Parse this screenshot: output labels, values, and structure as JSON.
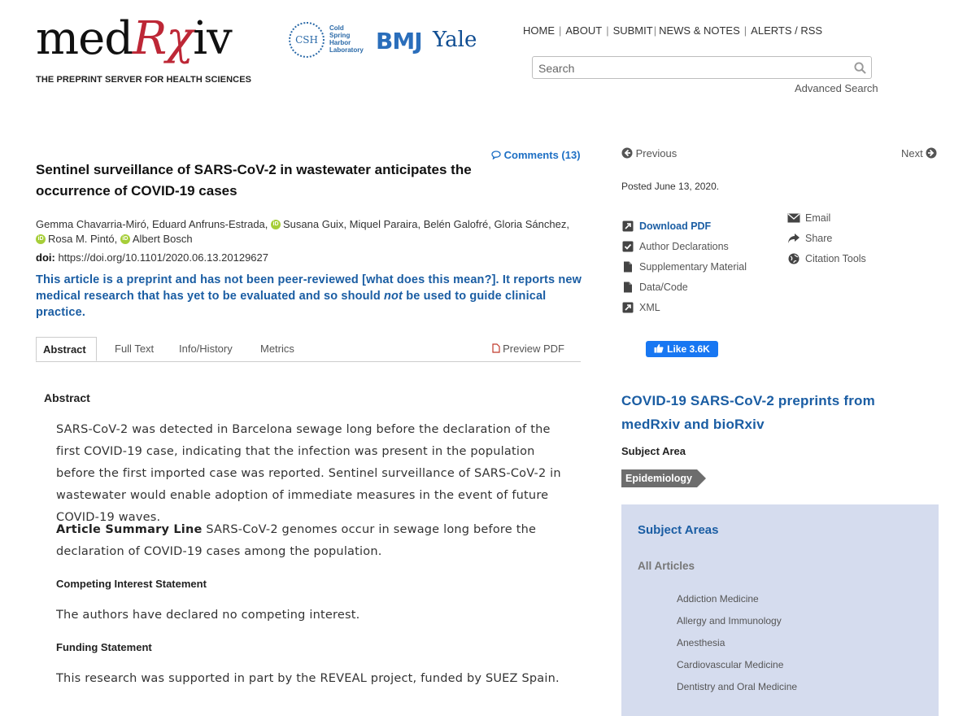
{
  "header": {
    "logo_prefix": "med",
    "logo_rx": "Rχ",
    "logo_suffix": "iv",
    "tagline": "THE PREPRINT SERVER FOR HEALTH SCIENCES",
    "partners": {
      "csh_abbr": "CSH",
      "csh_name": [
        "Cold",
        "Spring",
        "Harbor",
        "Laboratory"
      ],
      "bmj": "BMJ",
      "yale": "Yale"
    },
    "nav": [
      "HOME",
      "ABOUT",
      "SUBMIT",
      "NEWS & NOTES",
      "ALERTS / RSS"
    ],
    "search_placeholder": "Search",
    "advanced_search": "Advanced Search"
  },
  "article": {
    "comments": "Comments (13)",
    "title": "Sentinel surveillance of SARS-CoV-2 in wastewater anticipates the occurrence of COVID-19 cases",
    "authors": [
      "Gemma Chavarria-Miró, ",
      "Eduard Anfruns-Estrada, ",
      "Susana Guix, ",
      "Miquel Paraira, ",
      "Belén Galofré, ",
      "Gloria Sánchez, ",
      "Rosa M. Pintó, ",
      "Albert Bosch"
    ],
    "doi_label": "doi:",
    "doi_value": "https://doi.org/10.1101/2020.06.13.20129627",
    "notice_part1": "This article is a preprint and has not been peer-reviewed [what does this mean?]. It reports new medical research that has yet to be evaluated and so should ",
    "notice_not": "not",
    "notice_part2": " be used to guide clinical practice.",
    "tabs": [
      "Abstract",
      "Full Text",
      "Info/History",
      "Metrics"
    ],
    "preview_pdf": "Preview PDF",
    "abstract_heading": "Abstract",
    "abstract_text": "SARS-CoV-2 was detected in Barcelona sewage long before the declaration of the first COVID-19 case, indicating that the infection was present in the population before the first imported case was reported. Sentinel surveillance of SARS-CoV-2 in wastewater would enable adoption of immediate measures in the event of future COVID-19 waves.",
    "summary_label": "Article Summary Line",
    "summary_text": " SARS-CoV-2 genomes occur in sewage long before the declaration of COVID-19 cases among the population.",
    "competing_heading": "Competing Interest Statement",
    "competing_text": "The authors have declared no competing interest.",
    "funding_heading": "Funding Statement",
    "funding_text": "This research was supported in part by the REVEAL project, funded by SUEZ Spain."
  },
  "sidebar": {
    "previous": "Previous",
    "next": "Next",
    "posted": "Posted June 13, 2020.",
    "left_links": [
      "Download PDF",
      "Author Declarations",
      "Supplementary Material",
      "Data/Code",
      "XML"
    ],
    "right_links": [
      "Email",
      "Share",
      "Citation Tools"
    ],
    "fb_like": "Like 3.6K",
    "covid_heading": "COVID-19 SARS-CoV-2 preprints from medRxiv and bioRxiv",
    "subject_area_label": "Subject Area",
    "subject_tag": "Epidemiology",
    "panel_title": "Subject Areas",
    "panel_all": "All Articles",
    "panel_items": [
      "Addiction Medicine",
      "Allergy and Immunology",
      "Anesthesia",
      "Cardiovascular Medicine",
      "Dentistry and Oral Medicine"
    ]
  },
  "colors": {
    "brand_red": "#bd2736",
    "link_blue": "#1a5da3",
    "panel_bg": "#d5dcee",
    "orcid_green": "#a6ce39"
  }
}
